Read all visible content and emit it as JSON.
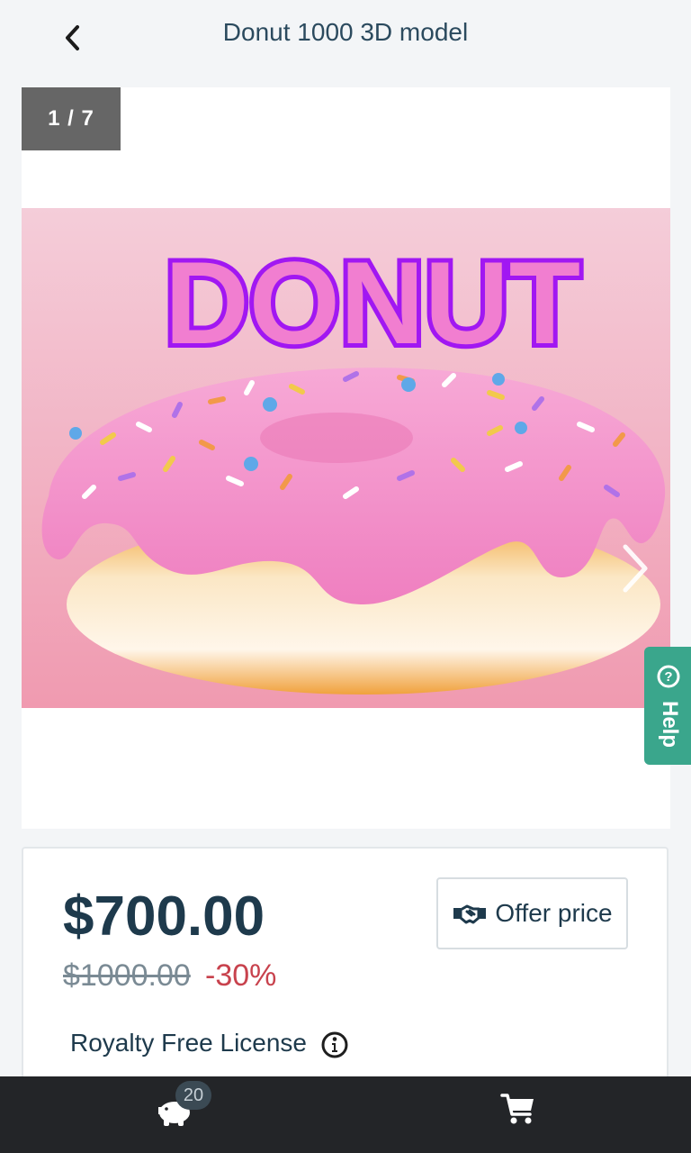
{
  "header": {
    "title": "Donut 1000 3D model",
    "back_icon": "chevron-left-icon"
  },
  "gallery": {
    "counter": "1 / 7",
    "image_text": "DONUT",
    "next_icon": "chevron-right-icon"
  },
  "help": {
    "label": "Help",
    "icon": "question-circle-icon"
  },
  "pricing": {
    "price": "$700.00",
    "old_price": "$1000.00",
    "discount": "-30%",
    "offer_label": "Offer price",
    "offer_icon": "handshake-icon",
    "license": "Royalty Free License",
    "info_icon": "info-circle-icon"
  },
  "bottom_nav": {
    "wallet_count": "20",
    "wallet_icon": "piggy-bank-icon",
    "cart_icon": "cart-icon"
  },
  "colors": {
    "accent": "#3aa68c",
    "discount": "#c8424d",
    "text": "#1e3a4c",
    "icing": "#f48bc8"
  }
}
